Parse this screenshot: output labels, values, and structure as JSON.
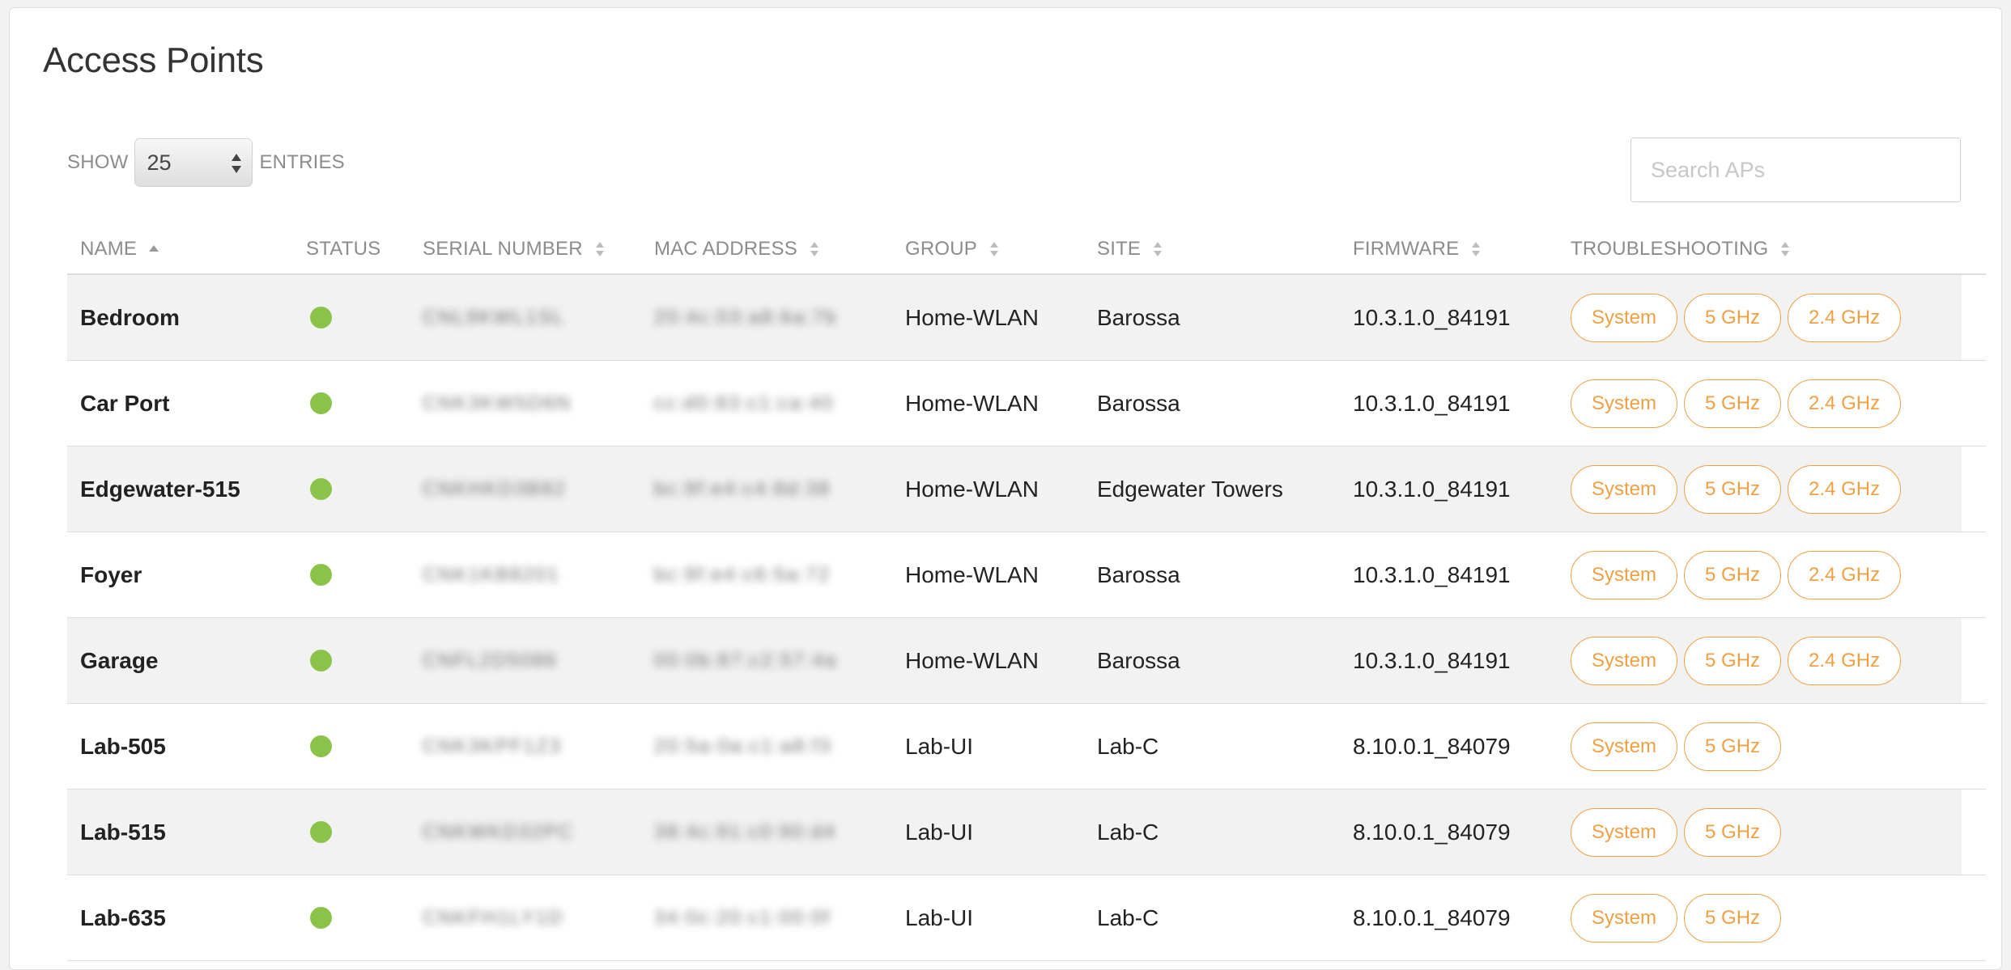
{
  "page": {
    "title": "Access Points"
  },
  "controls": {
    "show_label": "SHOW",
    "page_size": "25",
    "entries_label": "ENTRIES",
    "search_placeholder": "Search APs"
  },
  "columns": {
    "name": "NAME",
    "status": "STATUS",
    "serial": "SERIAL NUMBER",
    "mac": "MAC ADDRESS",
    "group": "GROUP",
    "site": "SITE",
    "firmware": "FIRMWARE",
    "troubleshooting": "TROUBLESHOOTING"
  },
  "rows": [
    {
      "name": "Bedroom",
      "status": "online",
      "serial": "CNL9KWL1SL",
      "mac": "20:4c:03:a8:6a:7b",
      "group": "Home-WLAN",
      "site": "Barossa",
      "firmware": "10.3.1.0_84191",
      "actions": [
        "System",
        "5 GHz",
        "2.4 GHz"
      ]
    },
    {
      "name": "Car Port",
      "status": "online",
      "serial": "CNK3KW5D6N",
      "mac": "cc:d0:83:c1:ca:40",
      "group": "Home-WLAN",
      "site": "Barossa",
      "firmware": "10.3.1.0_84191",
      "actions": [
        "System",
        "5 GHz",
        "2.4 GHz"
      ]
    },
    {
      "name": "Edgewater-515",
      "status": "online",
      "serial": "CNKHKD3B82",
      "mac": "bc:9f:e4:c4:8d:38",
      "group": "Home-WLAN",
      "site": "Edgewater Towers",
      "firmware": "10.3.1.0_84191",
      "actions": [
        "System",
        "5 GHz",
        "2.4 GHz"
      ]
    },
    {
      "name": "Foyer",
      "status": "online",
      "serial": "CNK1KB8201",
      "mac": "bc:9f:e4:c6:5a:72",
      "group": "Home-WLAN",
      "site": "Barossa",
      "firmware": "10.3.1.0_84191",
      "actions": [
        "System",
        "5 GHz",
        "2.4 GHz"
      ]
    },
    {
      "name": "Garage",
      "status": "online",
      "serial": "CNFL2D5086",
      "mac": "00:0b:87:c2:57:4a",
      "group": "Home-WLAN",
      "site": "Barossa",
      "firmware": "10.3.1.0_84191",
      "actions": [
        "System",
        "5 GHz",
        "2.4 GHz"
      ]
    },
    {
      "name": "Lab-505",
      "status": "online",
      "serial": "CNK3KPF1Z3",
      "mac": "20:5a:0a:c1:a8:f3",
      "group": "Lab-UI",
      "site": "Lab-C",
      "firmware": "8.10.0.1_84079",
      "actions": [
        "System",
        "5 GHz"
      ]
    },
    {
      "name": "Lab-515",
      "status": "online",
      "serial": "CNKWKD32PC",
      "mac": "38:4c:91:c0:90:d4",
      "group": "Lab-UI",
      "site": "Lab-C",
      "firmware": "8.10.0.1_84079",
      "actions": [
        "System",
        "5 GHz"
      ]
    },
    {
      "name": "Lab-635",
      "status": "online",
      "serial": "CNKFH1LY1D",
      "mac": "34:0c:20:c1:00:0f",
      "group": "Lab-UI",
      "site": "Lab-C",
      "firmware": "8.10.0.1_84079",
      "actions": [
        "System",
        "5 GHz"
      ]
    }
  ],
  "colors": {
    "status_online": "#8bc34a",
    "accent_orange": "#f0a044",
    "row_alt": "#f2f2f2"
  },
  "icons": {
    "sort_ascending": "sort-asc-icon",
    "sortable": "sort-both-icon",
    "select_arrows": "select-arrows-icon",
    "status": "status-dot-icon"
  }
}
